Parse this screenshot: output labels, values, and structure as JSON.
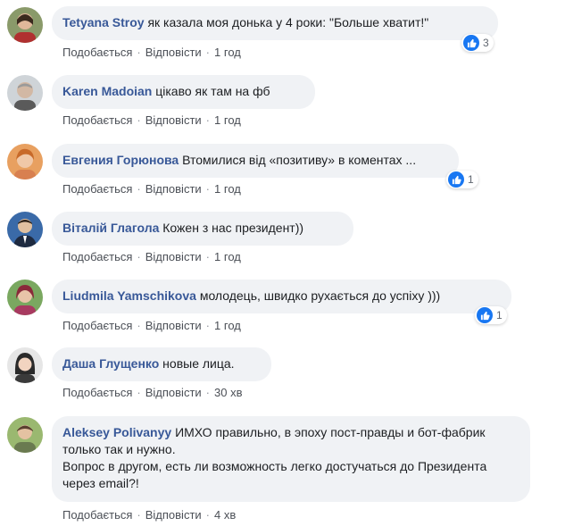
{
  "labels": {
    "like": "Подобається",
    "reply": "Відповісти",
    "sep": "·"
  },
  "colors": {
    "author": "#385898",
    "bubble": "#f0f2f5",
    "like": "#1877f2"
  },
  "comments": [
    {
      "author": "Tetyana Stroy",
      "text": "як казала моя донька у 4 роки: \"Больше хватит!\"",
      "time": "1 год",
      "reactions": "3",
      "reaction_icon": "like-icon"
    },
    {
      "author": "Karen Madoian",
      "text": "цікаво як там на фб",
      "time": "1 год"
    },
    {
      "author": "Евгения Горюнова",
      "text": "Втомилися від «позитиву» в коментах ...",
      "time": "1 год",
      "reactions": "1",
      "reaction_icon": "like-icon"
    },
    {
      "author": "Віталій Глагола",
      "text": "Кожен з нас президент))",
      "time": "1 год"
    },
    {
      "author": "Liudmila Yamschikova",
      "text": "молодець, швидко рухається до успіху )))",
      "time": "1 год",
      "reactions": "1",
      "reaction_icon": "like-icon"
    },
    {
      "author": "Даша Глущенко",
      "text": "новые лица.",
      "time": "30 хв"
    },
    {
      "author": "Aleksey Polivanyy",
      "text": "ИМХО правильно, в эпоху пост-правды и бот-фабрик только так и нужно.",
      "text2": "Вопрос в другом, есть ли возможность легко достучаться до Президента через email?!",
      "time": "4 хв"
    }
  ]
}
